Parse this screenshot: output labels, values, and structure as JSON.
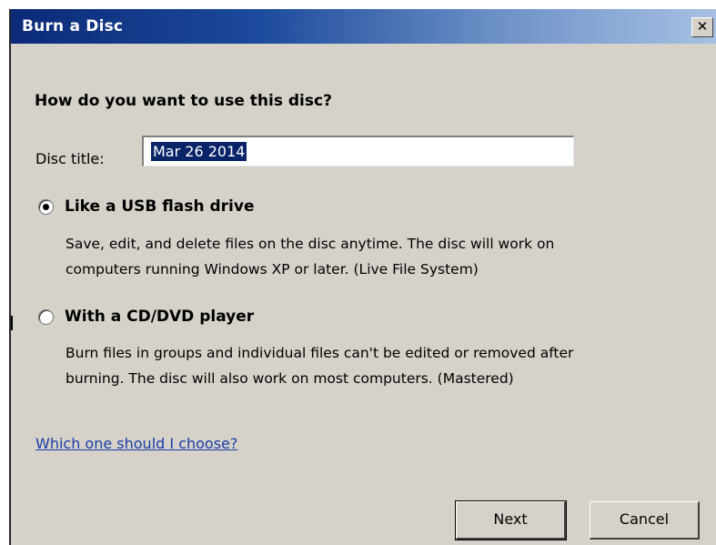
{
  "window": {
    "title": "Burn a Disc",
    "close_glyph": "✕"
  },
  "main": {
    "heading": "How do you want to use this disc?",
    "disc_title": {
      "label": "Disc title:",
      "value": "Mar 26 2014"
    },
    "options": [
      {
        "label": "Like a USB flash drive",
        "selected": true,
        "description_line1": "Save, edit, and delete files on the disc anytime. The disc will work on",
        "description_line2": "computers running Windows XP or later. (Live File System)"
      },
      {
        "label": "With a CD/DVD player",
        "selected": false,
        "description_line1": "Burn files in groups and individual files can't be edited or removed after",
        "description_line2": "burning. The disc will also work on most computers. (Mastered)"
      }
    ],
    "help_link": "Which one should I choose?"
  },
  "footer": {
    "next_label": "Next",
    "cancel_label": "Cancel"
  },
  "colors": {
    "titlebar_start": "#0b2a78",
    "titlebar_end": "#a7c0e3",
    "dialog_bg": "#d6d2ca",
    "selection": "#0a246a",
    "link": "#1a3ea6"
  }
}
